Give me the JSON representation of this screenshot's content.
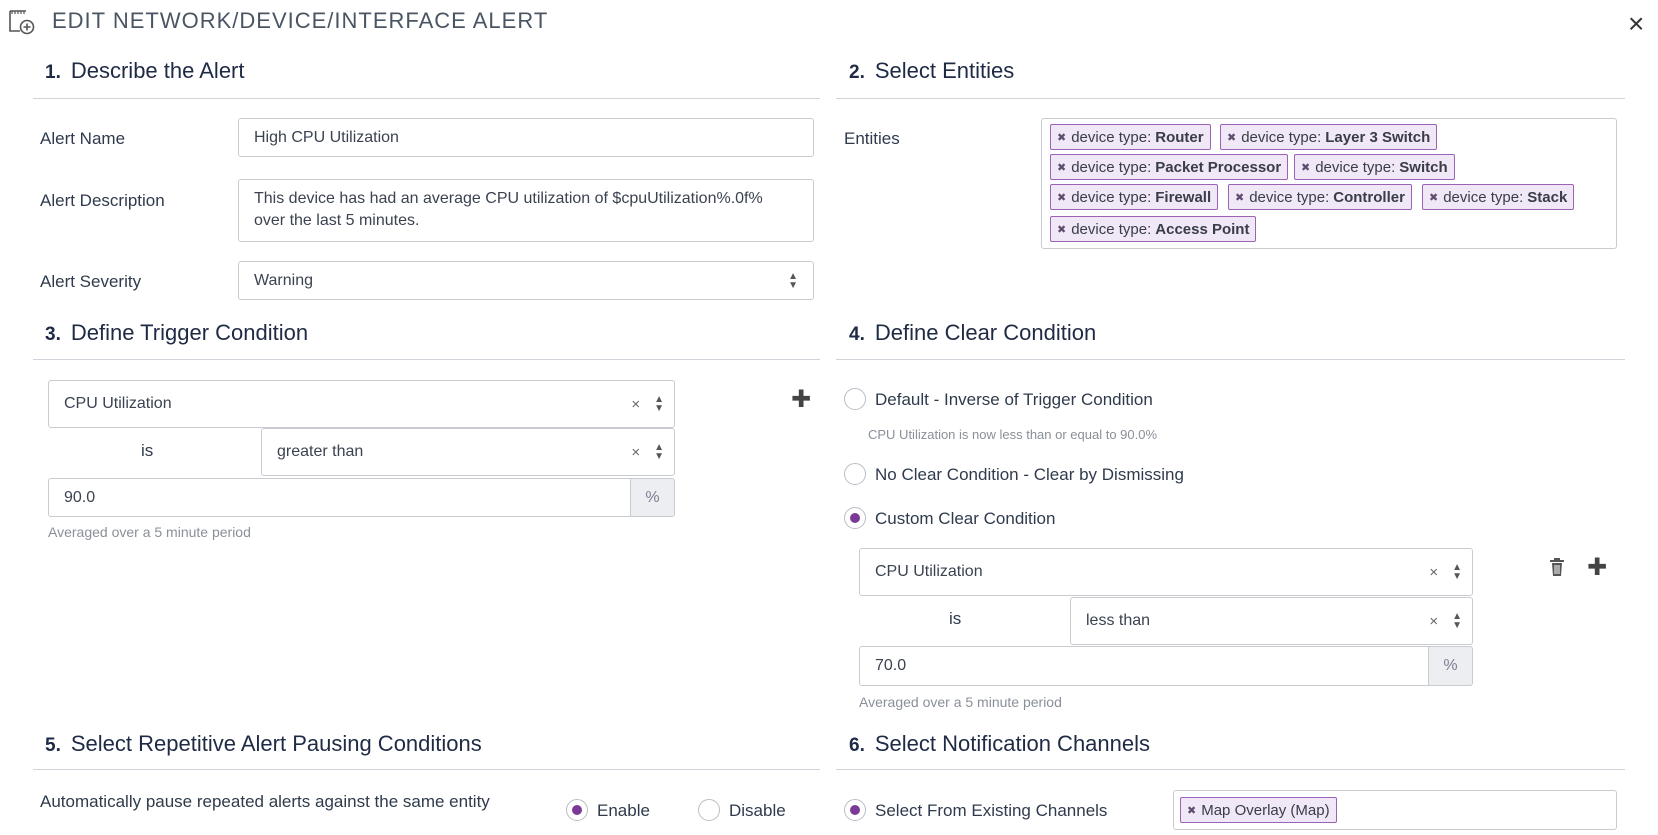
{
  "window": {
    "title": "EDIT NETWORK/DEVICE/INTERFACE ALERT"
  },
  "sections": {
    "describe": {
      "num": "1.",
      "title": "Describe the Alert"
    },
    "entities": {
      "num": "2.",
      "title": "Select Entities"
    },
    "trigger": {
      "num": "3.",
      "title": "Define Trigger Condition"
    },
    "clear": {
      "num": "4.",
      "title": "Define Clear Condition"
    },
    "pausing": {
      "num": "5.",
      "title": "Select Repetitive Alert Pausing Conditions"
    },
    "notify": {
      "num": "6.",
      "title": "Select Notification Channels"
    }
  },
  "describe": {
    "name_label": "Alert Name",
    "name_value": "High CPU Utilization",
    "desc_label": "Alert Description",
    "desc_value": "This device has had an average CPU utilization of $cpuUtilization%.0f% over the last 5 minutes.",
    "severity_label": "Alert Severity",
    "severity_value": "Warning"
  },
  "entities": {
    "label": "Entities",
    "chips": [
      {
        "prefix": "device type:",
        "value": "Router"
      },
      {
        "prefix": "device type:",
        "value": "Layer 3 Switch"
      },
      {
        "prefix": "device type:",
        "value": "Packet Processor"
      },
      {
        "prefix": "device type:",
        "value": "Switch"
      },
      {
        "prefix": "device type:",
        "value": "Firewall"
      },
      {
        "prefix": "device type:",
        "value": "Controller"
      },
      {
        "prefix": "device type:",
        "value": "Stack"
      },
      {
        "prefix": "device type:",
        "value": "Access Point"
      }
    ]
  },
  "trigger": {
    "metric": "CPU Utilization",
    "is_label": "is",
    "operator": "greater than",
    "threshold": "90.0",
    "unit": "%",
    "hint": "Averaged over a 5 minute period"
  },
  "clear": {
    "option_default": "Default - Inverse of Trigger Condition",
    "default_hint": "CPU Utilization is now less than or equal to 90.0%",
    "option_none": "No Clear Condition - Clear by Dismissing",
    "option_custom": "Custom Clear Condition",
    "metric": "CPU Utilization",
    "is_label": "is",
    "operator": "less than",
    "threshold": "70.0",
    "unit": "%",
    "hint": "Averaged over a 5 minute period"
  },
  "pausing": {
    "label": "Automatically pause repeated alerts against the same entity",
    "enable": "Enable",
    "disable": "Disable"
  },
  "notify": {
    "option": "Select From Existing Channels",
    "chip": "Map Overlay (Map)"
  },
  "icons": {
    "close": "×",
    "clear_x": "×",
    "chip_x": "✖",
    "plus": "✚",
    "trash": "🗑",
    "up": "▲",
    "down": "▼"
  }
}
